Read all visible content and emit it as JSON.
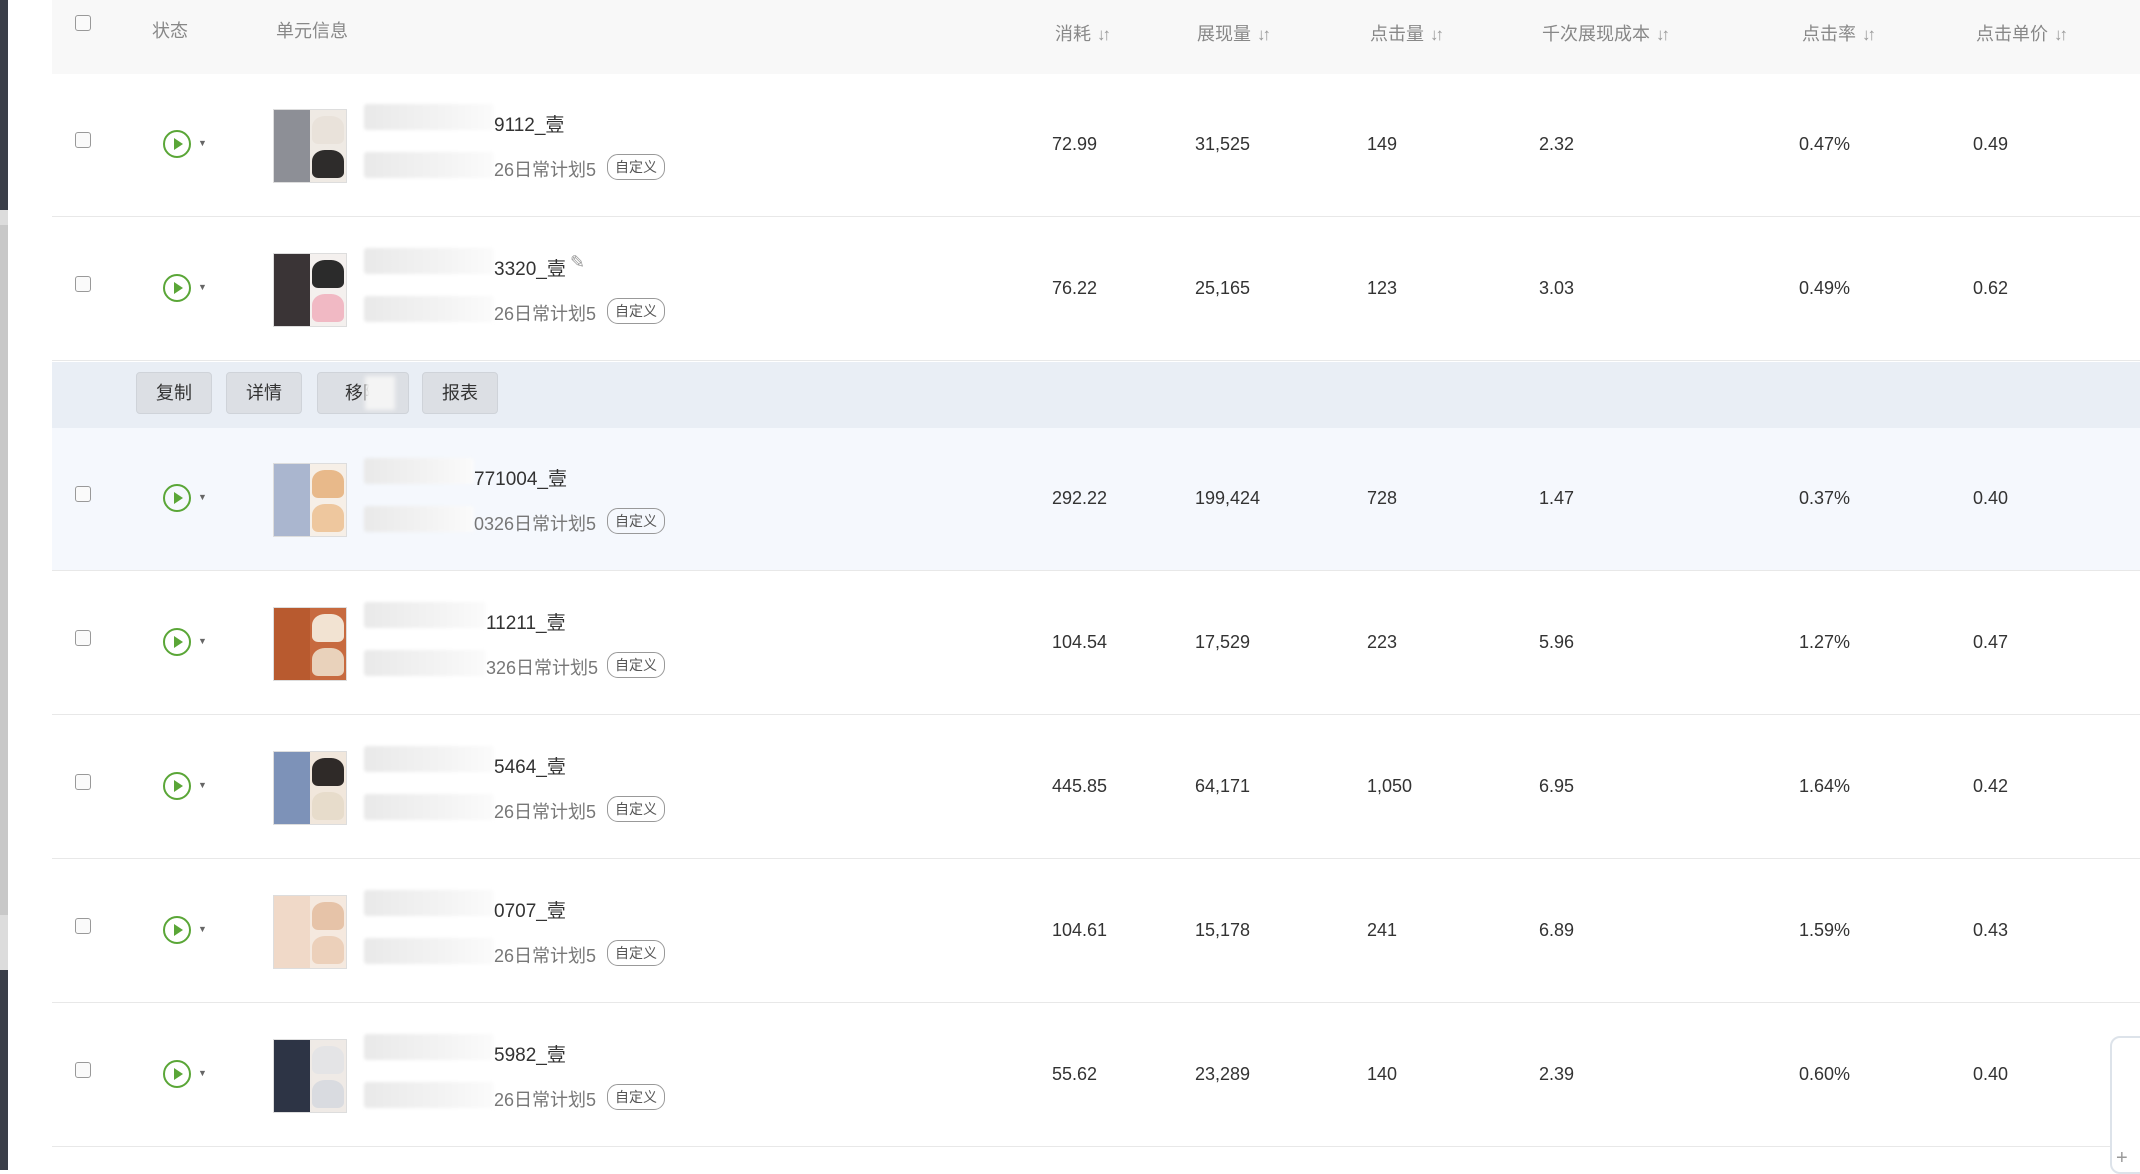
{
  "header": {
    "status": "状态",
    "unit_info": "单元信息",
    "cost": "消耗",
    "impressions": "展现量",
    "clicks": "点击量",
    "cpm": "千次展现成本",
    "ctr": "点击率",
    "cpc": "点击单价",
    "sort_icon": "↓↑"
  },
  "tag_label": "自定义",
  "actions": {
    "copy": "复制",
    "details": "详情",
    "move": "移除",
    "report": "报表"
  },
  "rows": [
    {
      "name": "9112_壹",
      "plan": "26日常计划5",
      "cost": "72.99",
      "impressions": "31,525",
      "clicks": "149",
      "cpm": "2.32",
      "ctr": "0.47%",
      "cpc": "0.49"
    },
    {
      "name": "3320_壹",
      "plan": "26日常计划5",
      "cost": "76.22",
      "impressions": "25,165",
      "clicks": "123",
      "cpm": "3.03",
      "ctr": "0.49%",
      "cpc": "0.62"
    },
    {
      "name": "771004_壹",
      "plan": "0326日常计划5",
      "cost": "292.22",
      "impressions": "199,424",
      "clicks": "728",
      "cpm": "1.47",
      "ctr": "0.37%",
      "cpc": "0.40"
    },
    {
      "name": "11211_壹",
      "plan": "326日常计划5",
      "cost": "104.54",
      "impressions": "17,529",
      "clicks": "223",
      "cpm": "5.96",
      "ctr": "1.27%",
      "cpc": "0.47"
    },
    {
      "name": "5464_壹",
      "plan": "26日常计划5",
      "cost": "445.85",
      "impressions": "64,171",
      "clicks": "1,050",
      "cpm": "6.95",
      "ctr": "1.64%",
      "cpc": "0.42"
    },
    {
      "name": "0707_壹",
      "plan": "26日常计划5",
      "cost": "104.61",
      "impressions": "15,178",
      "clicks": "241",
      "cpm": "6.89",
      "ctr": "1.59%",
      "cpc": "0.43"
    },
    {
      "name": "5982_壹",
      "plan": "26日常计划5",
      "cost": "55.62",
      "impressions": "23,289",
      "clicks": "140",
      "cpm": "2.39",
      "ctr": "0.60%",
      "cpc": "0.40"
    }
  ],
  "floating_widget": "+"
}
